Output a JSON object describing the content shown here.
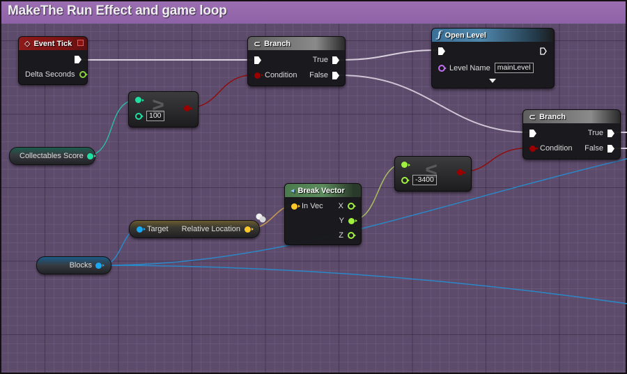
{
  "comment": {
    "title": "MakeThe Run Effect and game loop",
    "color": "#9a6eb0"
  },
  "nodes": {
    "event_tick": {
      "title": "Event Tick",
      "icon": "event-diamond-icon",
      "pins": {
        "delta": "Delta Seconds"
      }
    },
    "branch1": {
      "title": "Branch",
      "icon": "branch-icon",
      "pins": {
        "condition": "Condition",
        "true": "True",
        "false": "False"
      }
    },
    "open_level": {
      "title": "Open Level",
      "icon": "function-icon",
      "icon_glyph": "ƒ",
      "pins": {
        "level_name": "Level Name"
      },
      "level_name_value": "mainLevel",
      "expand_icon": "chevron-down-icon"
    },
    "compare1": {
      "operator": "≥",
      "operator_name": "greater-or-equal",
      "value": "100"
    },
    "compare2": {
      "operator": "≤",
      "operator_name": "less-or-equal",
      "value": "-3400"
    },
    "branch2": {
      "title": "Branch",
      "icon": "branch-icon",
      "pins": {
        "condition": "Condition",
        "true": "True",
        "false": "False"
      }
    },
    "break_vector": {
      "title": "Break Vector",
      "icon": "vector-icon",
      "pins": {
        "in_vec": "In Vec",
        "x": "X",
        "y": "Y",
        "z": "Z"
      }
    },
    "relative_location": {
      "pins": {
        "target": "Target",
        "output": "Relative Location"
      }
    },
    "collectables_score": {
      "label": "Collectables Score"
    },
    "blocks": {
      "label": "Blocks"
    }
  },
  "colors": {
    "exec": "#ffffff",
    "bool": "#9b0000",
    "int": "#1fe0a0",
    "float": "#a0f040",
    "object": "#1aa8f0",
    "vector": "#ffc82a",
    "name": "#c070f0",
    "event_header": "#8e1a1a",
    "graph_background": "#5d4b6b"
  }
}
